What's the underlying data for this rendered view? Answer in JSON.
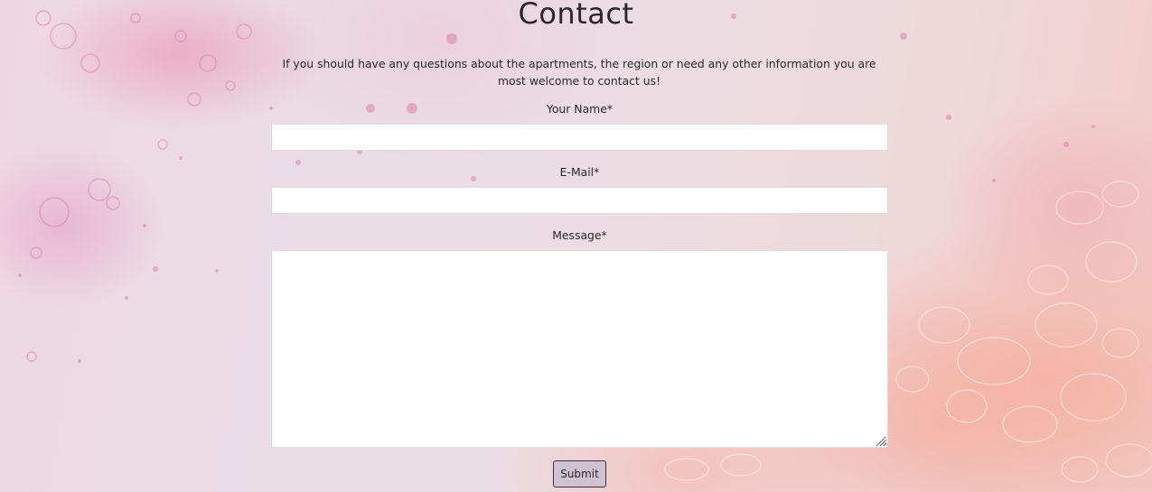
{
  "page": {
    "title": "Contact",
    "intro": "If you should have any questions about the apartments, the region or need any other information you are most welcome to contact us!"
  },
  "form": {
    "name_label": "Your Name*",
    "name_value": "",
    "email_label": "E-Mail*",
    "email_value": "",
    "message_label": "Message*",
    "message_value": "",
    "submit_label": "Submit"
  },
  "colors": {
    "text": "#2b2728",
    "button_bg": "#cfc2d2",
    "button_border": "#3b3240",
    "field_bg": "#ffffff"
  }
}
